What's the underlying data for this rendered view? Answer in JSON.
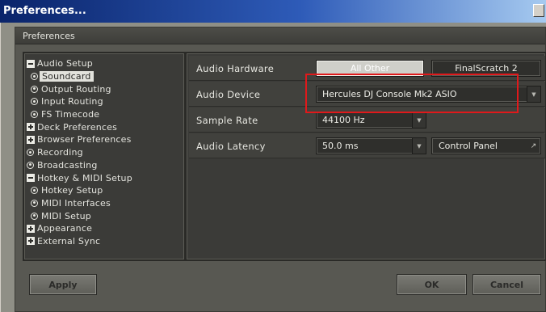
{
  "window": {
    "title": "Preferences..."
  },
  "dialog": {
    "header": "Preferences"
  },
  "tree": [
    {
      "label": "Audio Setup",
      "level": 0,
      "icon": "minus-box-icon"
    },
    {
      "label": "Soundcard",
      "level": 1,
      "icon": "radio-icon",
      "selected": true
    },
    {
      "label": "Output Routing",
      "level": 1,
      "icon": "radio-icon"
    },
    {
      "label": "Input Routing",
      "level": 1,
      "icon": "radio-icon"
    },
    {
      "label": "FS Timecode",
      "level": 1,
      "icon": "radio-icon"
    },
    {
      "label": "Deck Preferences",
      "level": 0,
      "icon": "plus-box-icon"
    },
    {
      "label": "Browser Preferences",
      "level": 0,
      "icon": "plus-box-icon"
    },
    {
      "label": "Recording",
      "level": 0,
      "icon": "radio-icon"
    },
    {
      "label": "Broadcasting",
      "level": 0,
      "icon": "radio-icon"
    },
    {
      "label": "Hotkey & MIDI Setup",
      "level": 0,
      "icon": "minus-box-icon"
    },
    {
      "label": "Hotkey Setup",
      "level": 1,
      "icon": "radio-icon"
    },
    {
      "label": "MIDI Interfaces",
      "level": 1,
      "icon": "radio-icon"
    },
    {
      "label": "MIDI Setup",
      "level": 1,
      "icon": "radio-icon"
    },
    {
      "label": "Appearance",
      "level": 0,
      "icon": "plus-box-icon"
    },
    {
      "label": "External Sync",
      "level": 0,
      "icon": "plus-box-icon"
    }
  ],
  "settings": {
    "audio_hardware": {
      "label": "Audio Hardware",
      "options": [
        "All Other",
        "FinalScratch 2"
      ],
      "selected": "All Other"
    },
    "audio_device": {
      "label": "Audio Device",
      "value": "Hercules DJ Console Mk2 ASIO"
    },
    "sample_rate": {
      "label": "Sample Rate",
      "value": "44100 Hz"
    },
    "audio_latency": {
      "label": "Audio Latency",
      "value": "50.0 ms",
      "control_panel_label": "Control Panel"
    }
  },
  "footer": {
    "apply_label": "Apply",
    "ok_label": "OK",
    "cancel_label": "Cancel"
  },
  "colors": {
    "highlight": "#e0191b",
    "panel_bg": "#3b3b38",
    "dialog_bg": "#585852",
    "title_bar": "#0a246a"
  }
}
